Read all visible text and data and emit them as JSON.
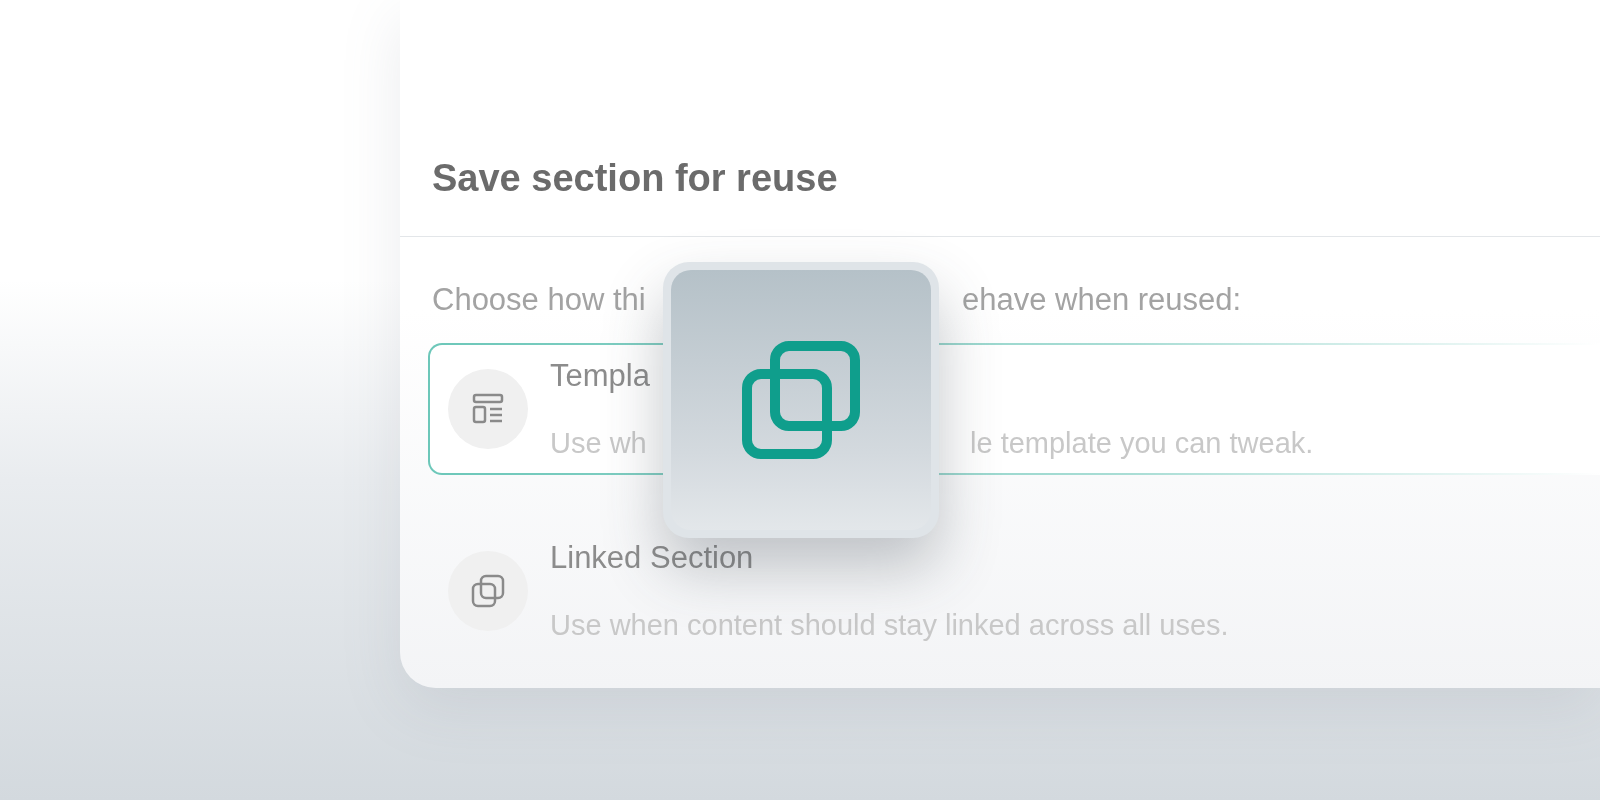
{
  "dialog": {
    "title": "Save section for reuse",
    "prompt_parts": [
      "Choose how thi",
      "ehave when reused:"
    ]
  },
  "options": [
    {
      "kind": "template",
      "title": "Templa",
      "description_parts": [
        "Use wh",
        "le template you can tweak."
      ],
      "selected": true
    },
    {
      "kind": "linked",
      "title": "Linked Section",
      "description_parts": [
        "Use when content should stay linked across all uses."
      ],
      "selected": false
    }
  ]
}
